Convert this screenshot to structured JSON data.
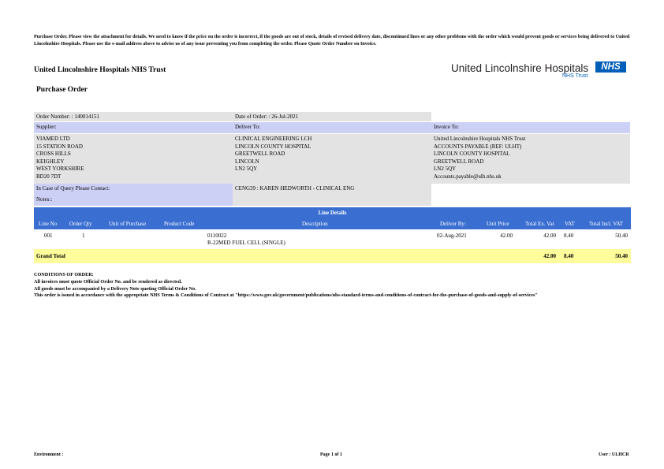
{
  "notice": "Purchase Order. Please view the attachment for details. We need to know if the price on the order is incorrect, if the goods are out of stock, details of revised delivery date, discontinued lines or any other problems with the order which would prevent goods or services being delivered to United Lincolnshire Hospitals. Please use the e-mail address above to advise us of any issue preventing you from completing the order. Please Quote Order Number on Invoice.",
  "header": {
    "organisation": "United Lincolnshire Hospitals NHS Trust",
    "document_title": "Purchase Order",
    "logo": {
      "name": "United Lincolnshire Hospitals",
      "nhs_mark": "NHS",
      "trust": "NHS Trust",
      "nhs_color": "#005eb8"
    }
  },
  "order": {
    "order_number": "Order Number: : 140014151",
    "date_of_order": "Date of Order: : 26-Jul-2021",
    "supplier_label": "Supplier:",
    "deliver_to_label": "Deliver To:",
    "invoice_to_label": "Invoice To:",
    "supplier_lines": [
      "VIAMED LTD",
      "15 STATION ROAD",
      "CROSS HILLS",
      "KEIGHLEY",
      "WEST YORKSHIRE",
      "BD20 7DT"
    ],
    "deliver_lines": [
      "CLINICAL ENGINEERING LCH",
      "LINCOLN COUNTY HOSPITAL",
      "GREETWELL ROAD",
      "LINCOLN",
      "LN2 5QY"
    ],
    "invoice_lines": [
      "United Lincolnshire Hospitals NHS Trust",
      "ACCOUNTS PAYABLE (REF: ULHT)",
      "LINCOLN COUNTY HOSPITAL",
      "GREETWELL ROAD",
      "LN2 5QY",
      "Accounts.payable@ulh.nhs.uk"
    ],
    "query_label": "In Case of Query Please Contact:",
    "query_contact": "CENG39 : KAREN HEDWORTH - CLINICAL ENG",
    "notes_label": "Notes::"
  },
  "line_details": {
    "title": "Line Details",
    "columns": [
      "Line No",
      "Order Qty",
      "Unit of Purchase",
      "Product Code",
      "Description",
      "Deliver By:",
      "Unit Price",
      "Total Ex. Vat",
      "VAT",
      "Total Incl. VAT"
    ],
    "rows": [
      {
        "line_no": "001",
        "qty": "1",
        "unit": "",
        "product_code": "",
        "desc_code": "0110022",
        "desc_text": "R-22MED FUEL CELL (SINGLE)",
        "deliver_by": "02-Aug-2021",
        "unit_price": "42.00",
        "total_ex_vat": "42.00",
        "vat": "8.40",
        "total_incl_vat": "50.40"
      }
    ],
    "grand_total": {
      "label": "Grand Total",
      "total_ex_vat": "42.00",
      "vat": "8.40",
      "total_incl_vat": "50.40"
    }
  },
  "conditions": {
    "title": "CONDITIONS OF ORDER:",
    "lines": [
      "All invoices must quote Official Order No. and be rendered as directed.",
      "All goods must be accompanied by a Delivery Note quoting Official Order No.",
      "This order is issued in accordance with the appropriate NHS Terms & Conditions of Contract at \"https://www.gov.uk/government/publications/nhs-standard-terms-and-conditions-of-contract-for-the-purchase-of-goods-and-supply-of-services\""
    ]
  },
  "footer": {
    "environment": "Environment :",
    "page": "Page 1 of 1",
    "user": "User : ULHCR"
  }
}
